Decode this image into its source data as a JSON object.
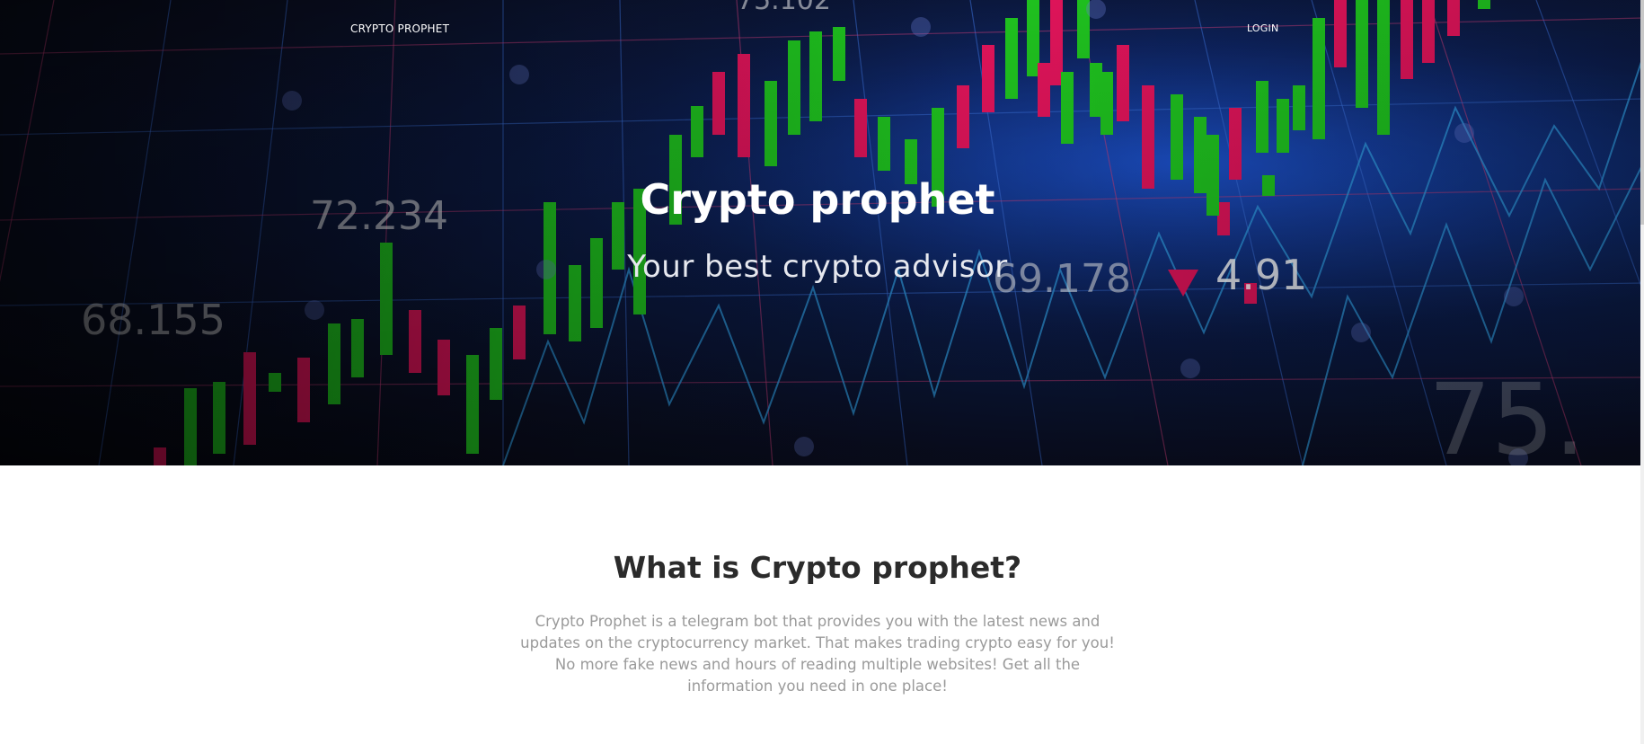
{
  "nav": {
    "brand": "CRYPTO PROPHET",
    "login": "LOGIN"
  },
  "hero": {
    "title": "Crypto prophet",
    "subtitle": "Your best crypto advisor",
    "background_numbers": [
      "75.102",
      "72.234",
      "68.155",
      "69.178",
      "4.91",
      "75."
    ],
    "colors": {
      "bullish": "#1fc21f",
      "bearish": "#e0145a",
      "grid_blue": "#3a6fd8",
      "grid_pink": "#c83c78"
    }
  },
  "about": {
    "title": "What is Crypto prophet?",
    "text": "Crypto Prophet is a telegram bot that provides you with the latest news and updates on the cryptocurrency market. That makes trading crypto easy for you! No more fake news and hours of reading multiple websites! Get all the information you need in one place!"
  }
}
